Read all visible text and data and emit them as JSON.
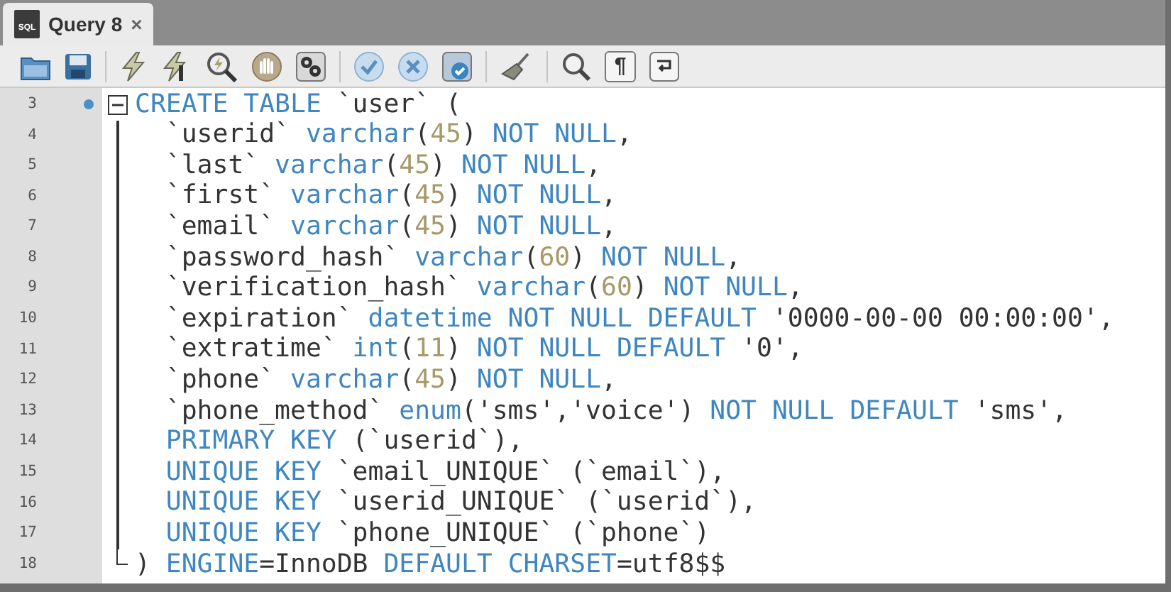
{
  "tab": {
    "icon_label": "SQL",
    "title": "Query 8",
    "close": "×",
    "selected": true
  },
  "toolbar": {
    "invisibles_glyph": "¶"
  },
  "editor": {
    "lines": [
      {
        "number": "3",
        "marker": true,
        "expanded": true,
        "tokens": [
          {
            "kind": "keyword",
            "text": "CREATE TABLE"
          },
          {
            "kind": "plain",
            "text": " `user` ("
          }
        ],
        "children": [
          {
            "number": "4",
            "tokens": [
              {
                "kind": "plain",
                "text": "`userid` "
              },
              {
                "kind": "keyword",
                "text": "varchar"
              },
              {
                "kind": "plain",
                "text": "("
              },
              {
                "kind": "number",
                "text": "45"
              },
              {
                "kind": "plain",
                "text": ") "
              },
              {
                "kind": "keyword",
                "text": "NOT NULL"
              },
              {
                "kind": "plain",
                "text": ","
              }
            ]
          },
          {
            "number": "5",
            "tokens": [
              {
                "kind": "plain",
                "text": "`last` "
              },
              {
                "kind": "keyword",
                "text": "varchar"
              },
              {
                "kind": "plain",
                "text": "("
              },
              {
                "kind": "number",
                "text": "45"
              },
              {
                "kind": "plain",
                "text": ") "
              },
              {
                "kind": "keyword",
                "text": "NOT NULL"
              },
              {
                "kind": "plain",
                "text": ","
              }
            ]
          },
          {
            "number": "6",
            "tokens": [
              {
                "kind": "plain",
                "text": "`first` "
              },
              {
                "kind": "keyword",
                "text": "varchar"
              },
              {
                "kind": "plain",
                "text": "("
              },
              {
                "kind": "number",
                "text": "45"
              },
              {
                "kind": "plain",
                "text": ") "
              },
              {
                "kind": "keyword",
                "text": "NOT NULL"
              },
              {
                "kind": "plain",
                "text": ","
              }
            ]
          },
          {
            "number": "7",
            "tokens": [
              {
                "kind": "plain",
                "text": "`email` "
              },
              {
                "kind": "keyword",
                "text": "varchar"
              },
              {
                "kind": "plain",
                "text": "("
              },
              {
                "kind": "number",
                "text": "45"
              },
              {
                "kind": "plain",
                "text": ") "
              },
              {
                "kind": "keyword",
                "text": "NOT NULL"
              },
              {
                "kind": "plain",
                "text": ","
              }
            ]
          },
          {
            "number": "8",
            "tokens": [
              {
                "kind": "plain",
                "text": "`password_hash` "
              },
              {
                "kind": "keyword",
                "text": "varchar"
              },
              {
                "kind": "plain",
                "text": "("
              },
              {
                "kind": "number",
                "text": "60"
              },
              {
                "kind": "plain",
                "text": ") "
              },
              {
                "kind": "keyword",
                "text": "NOT NULL"
              },
              {
                "kind": "plain",
                "text": ","
              }
            ]
          },
          {
            "number": "9",
            "tokens": [
              {
                "kind": "plain",
                "text": "`verification_hash` "
              },
              {
                "kind": "keyword",
                "text": "varchar"
              },
              {
                "kind": "plain",
                "text": "("
              },
              {
                "kind": "number",
                "text": "60"
              },
              {
                "kind": "plain",
                "text": ") "
              },
              {
                "kind": "keyword",
                "text": "NOT NULL"
              },
              {
                "kind": "plain",
                "text": ","
              }
            ]
          },
          {
            "number": "10",
            "tokens": [
              {
                "kind": "plain",
                "text": "`expiration` "
              },
              {
                "kind": "keyword",
                "text": "datetime NOT NULL DEFAULT"
              },
              {
                "kind": "plain",
                "text": " '0000-00-00 00:00:00',"
              }
            ]
          },
          {
            "number": "11",
            "tokens": [
              {
                "kind": "plain",
                "text": "`extratime` "
              },
              {
                "kind": "keyword",
                "text": "int"
              },
              {
                "kind": "plain",
                "text": "("
              },
              {
                "kind": "number",
                "text": "11"
              },
              {
                "kind": "plain",
                "text": ") "
              },
              {
                "kind": "keyword",
                "text": "NOT NULL DEFAULT"
              },
              {
                "kind": "plain",
                "text": " '0',"
              }
            ]
          },
          {
            "number": "12",
            "tokens": [
              {
                "kind": "plain",
                "text": "`phone` "
              },
              {
                "kind": "keyword",
                "text": "varchar"
              },
              {
                "kind": "plain",
                "text": "("
              },
              {
                "kind": "number",
                "text": "45"
              },
              {
                "kind": "plain",
                "text": ") "
              },
              {
                "kind": "keyword",
                "text": "NOT NULL"
              },
              {
                "kind": "plain",
                "text": ","
              }
            ]
          },
          {
            "number": "13",
            "tokens": [
              {
                "kind": "plain",
                "text": "`phone_method` "
              },
              {
                "kind": "keyword",
                "text": "enum"
              },
              {
                "kind": "plain",
                "text": "('sms','voice') "
              },
              {
                "kind": "keyword",
                "text": "NOT NULL DEFAULT"
              },
              {
                "kind": "plain",
                "text": " 'sms',"
              }
            ]
          },
          {
            "number": "14",
            "tokens": [
              {
                "kind": "keyword",
                "text": "PRIMARY KEY"
              },
              {
                "kind": "plain",
                "text": " (`userid`),"
              }
            ]
          },
          {
            "number": "15",
            "tokens": [
              {
                "kind": "keyword",
                "text": "UNIQUE KEY"
              },
              {
                "kind": "plain",
                "text": " `email_UNIQUE` (`email`),"
              }
            ]
          },
          {
            "number": "16",
            "tokens": [
              {
                "kind": "keyword",
                "text": "UNIQUE KEY"
              },
              {
                "kind": "plain",
                "text": " `userid_UNIQUE` (`userid`),"
              }
            ]
          },
          {
            "number": "17",
            "tokens": [
              {
                "kind": "keyword",
                "text": "UNIQUE KEY"
              },
              {
                "kind": "plain",
                "text": " `phone_UNIQUE` (`phone`)"
              }
            ]
          }
        ]
      },
      {
        "number": "18",
        "fold_end": true,
        "tokens": [
          {
            "kind": "plain",
            "text": ") "
          },
          {
            "kind": "keyword",
            "text": "ENGINE"
          },
          {
            "kind": "plain",
            "text": "=InnoDB "
          },
          {
            "kind": "keyword",
            "text": "DEFAULT CHARSET"
          },
          {
            "kind": "plain",
            "text": "=utf8$$"
          }
        ]
      }
    ]
  }
}
